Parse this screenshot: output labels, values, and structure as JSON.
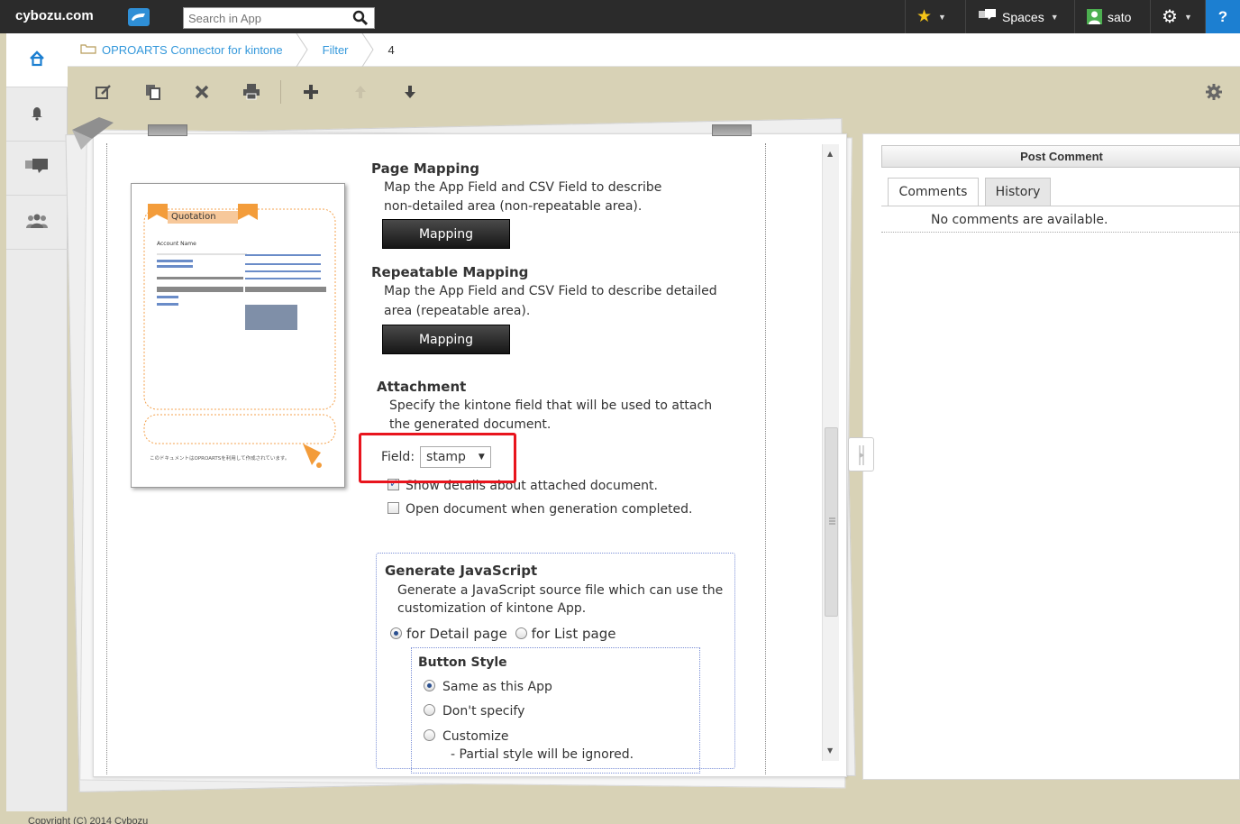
{
  "topbar": {
    "logo": "cybozu.com",
    "search_placeholder": "Search in App",
    "spaces_label": "Spaces",
    "user_name": "sato",
    "help_label": "?"
  },
  "breadcrumb": {
    "app": "OPROARTS Connector for kintone",
    "filter": "Filter",
    "record": "4"
  },
  "settings": {
    "page_mapping": {
      "title": "Page Mapping",
      "line1": "Map the App Field and CSV Field to describe",
      "line2": "non-detailed area (non-repeatable area).",
      "button": "Mapping"
    },
    "repeatable_mapping": {
      "title": "Repeatable Mapping",
      "line1": "Map the App Field and CSV Field to describe detailed",
      "line2": "area (repeatable area).",
      "button": "Mapping"
    },
    "attachment": {
      "title": "Attachment",
      "line1": "Specify the kintone field that will be used to attach",
      "line2": "the generated document.",
      "field_label": "Field:",
      "field_value": "stamp",
      "show_details": "Show details about attached document.",
      "open_document": "Open document when generation completed."
    },
    "generate_js": {
      "title": "Generate JavaScript",
      "line1": "Generate a JavaScript source file which can use the",
      "line2": "customization of kintone App.",
      "detail_page": "for Detail page",
      "list_page": "for List page"
    },
    "button_style": {
      "title": "Button Style",
      "same": "Same as this App",
      "dont": "Don't specify",
      "customize": "Customize",
      "note": "- Partial style will be ignored."
    }
  },
  "preview": {
    "title": "Quotation",
    "account_label": "Account Name",
    "footer_text": "このドキュメントはOPROARTSを利用して作成されています。"
  },
  "comments": {
    "post_button": "Post Comment",
    "tab_comments": "Comments",
    "tab_history": "History",
    "empty": "No comments are available."
  },
  "footer": {
    "copyright": "Copyright (C) 2014 Cybozu"
  }
}
